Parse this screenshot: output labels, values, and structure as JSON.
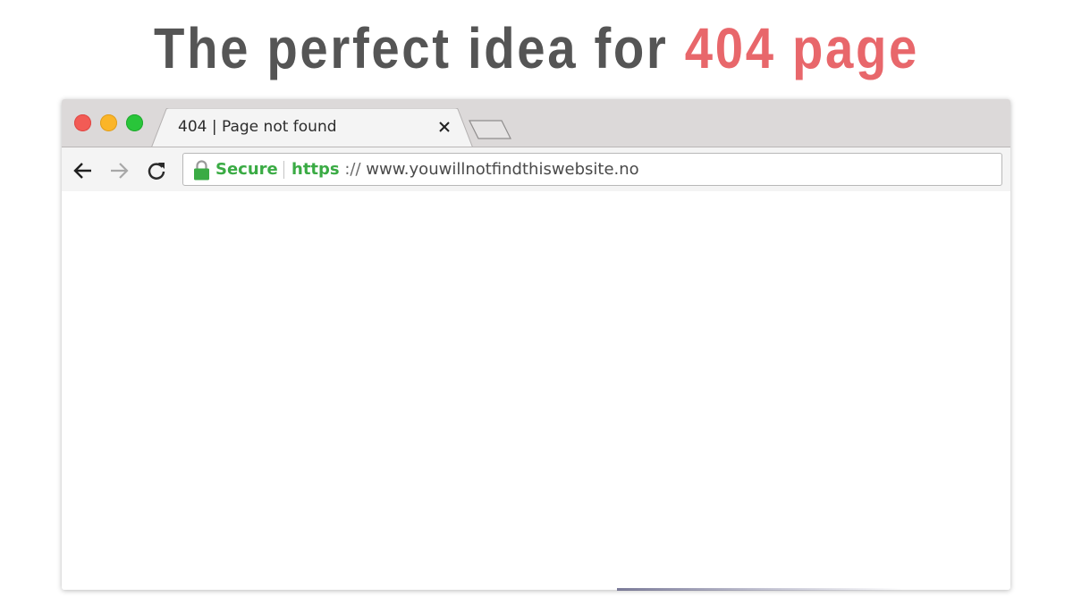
{
  "headline": {
    "text": "The perfect idea for",
    "accent": "404 page",
    "text_color": "#555555",
    "accent_color": "#e8676b"
  },
  "window": {
    "traffic_lights": [
      "close",
      "minimize",
      "zoom"
    ]
  },
  "tab": {
    "title": "404 | Page not found",
    "close_glyph": "×"
  },
  "toolbar": {
    "back_icon": "arrow-left-icon",
    "forward_icon": "arrow-right-icon",
    "reload_icon": "reload-icon"
  },
  "omnibox": {
    "secure_label": "Secure",
    "scheme": "https",
    "separator": "://",
    "host": "www.youwillnotfindthiswebsite.no",
    "secure_color": "#3aab44"
  }
}
